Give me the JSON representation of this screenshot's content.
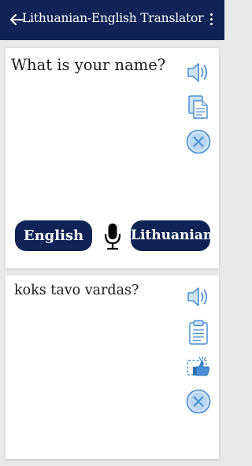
{
  "app_bar": {
    "title": "Lithuanian-English Translator",
    "back_icon": "arrow-left-icon",
    "menu_icon": "more-vert-icon"
  },
  "source_panel": {
    "text": "What is your name?",
    "icons": [
      "speaker-icon",
      "copy-icon",
      "clear-icon"
    ],
    "source_language": "English",
    "target_language": "Lithuanian",
    "mic_icon": "microphone-icon"
  },
  "result_panel": {
    "text": "koks tavo vardas?",
    "icons": [
      "speaker-icon",
      "clipboard-icon",
      "thumbs-up-icon",
      "clear-icon"
    ]
  },
  "colors": {
    "primary": "#0f2454",
    "icon_blue": "#4a8fd6",
    "icon_fill": "#cfe3f7",
    "background": "#e9e9e9"
  }
}
